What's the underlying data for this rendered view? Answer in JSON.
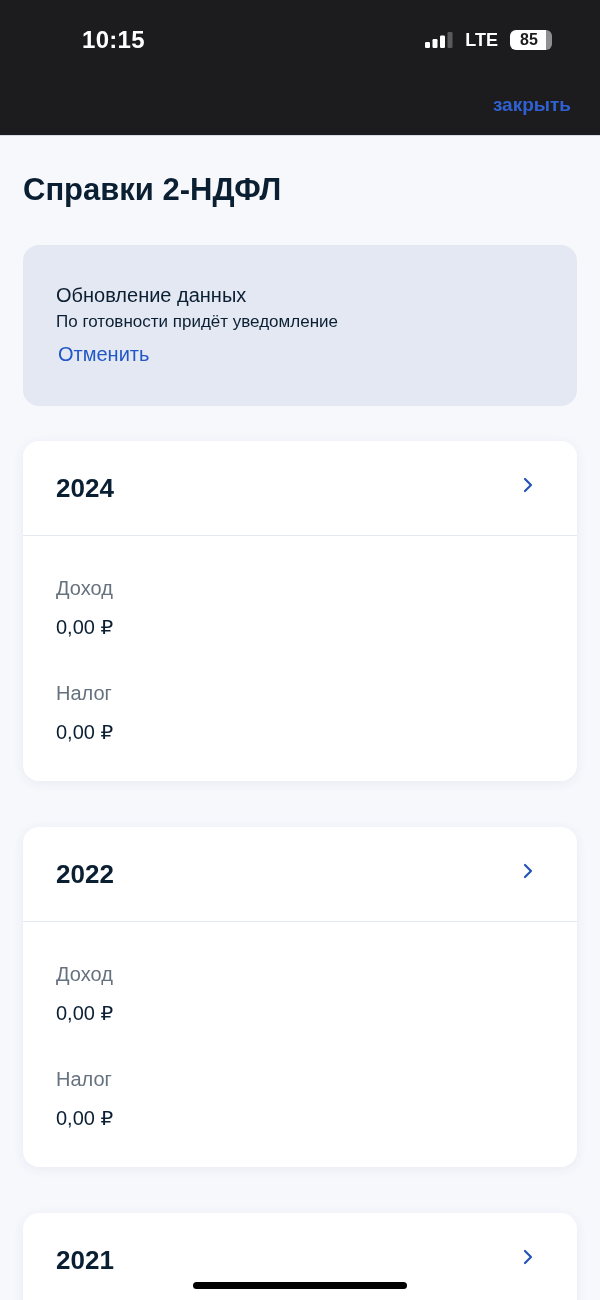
{
  "status_bar": {
    "time": "10:15",
    "network": "LTE",
    "battery": "85"
  },
  "header": {
    "close_link": "закрыть"
  },
  "page": {
    "title": "Справки 2-НДФЛ"
  },
  "notice": {
    "title": "Обновление данных",
    "text": "По готовности придёт уведомление",
    "action": "Отменить"
  },
  "years": [
    {
      "year": "2024",
      "fields": [
        {
          "label": "Доход",
          "value": "0,00 ₽"
        },
        {
          "label": "Налог",
          "value": "0,00 ₽"
        }
      ]
    },
    {
      "year": "2022",
      "fields": [
        {
          "label": "Доход",
          "value": "0,00 ₽"
        },
        {
          "label": "Налог",
          "value": "0,00 ₽"
        }
      ]
    },
    {
      "year": "2021"
    }
  ]
}
